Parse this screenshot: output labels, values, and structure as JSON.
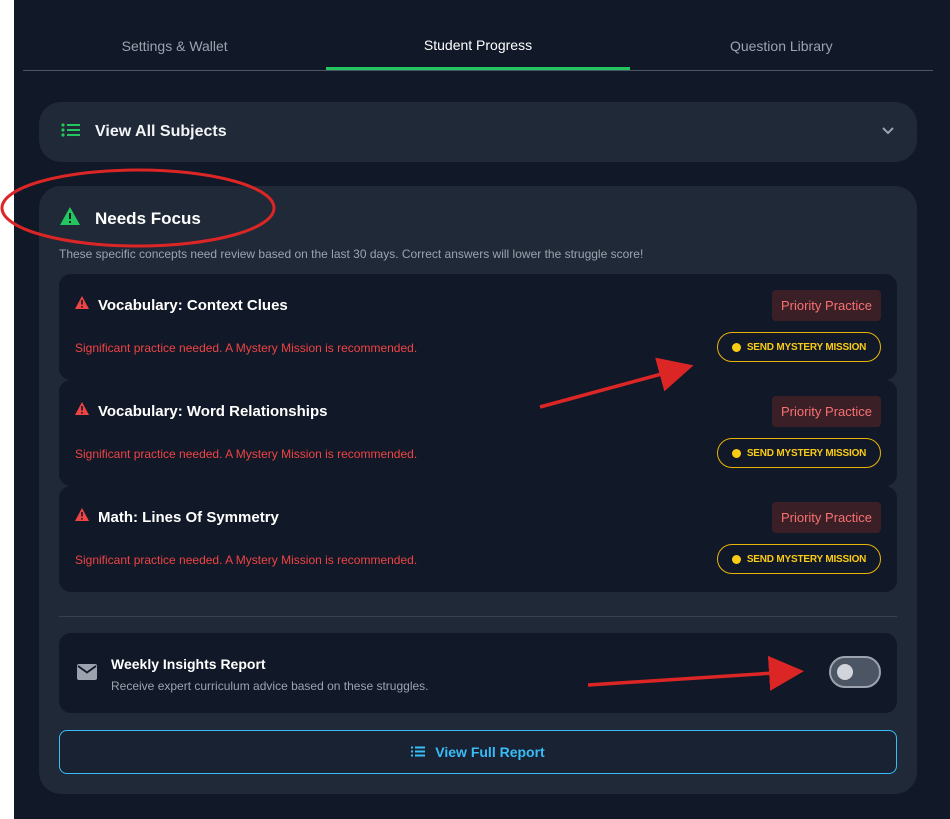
{
  "tabs": [
    {
      "label": "Settings & Wallet",
      "active": false
    },
    {
      "label": "Student Progress",
      "active": true
    },
    {
      "label": "Question Library",
      "active": false
    }
  ],
  "subjects": {
    "title": "View All Subjects",
    "icon": "list-icon",
    "chevron": "chevron-down-icon"
  },
  "focus": {
    "title": "Needs Focus",
    "icon": "warning-icon",
    "description": "These specific concepts need review based on the last 30 days. Correct answers will lower the struggle score!",
    "concepts": [
      {
        "name": "Vocabulary: Context Clues",
        "badge": "Priority Practice",
        "message": "Significant practice needed. A Mystery Mission is recommended.",
        "action": "SEND MYSTERY MISSION"
      },
      {
        "name": "Vocabulary: Word Relationships",
        "badge": "Priority Practice",
        "message": "Significant practice needed. A Mystery Mission is recommended.",
        "action": "SEND MYSTERY MISSION"
      },
      {
        "name": "Math: Lines Of Symmetry",
        "badge": "Priority Practice",
        "message": "Significant practice needed. A Mystery Mission is recommended.",
        "action": "SEND MYSTERY MISSION"
      }
    ]
  },
  "insights": {
    "title": "Weekly Insights Report",
    "subtitle": "Receive expert curriculum advice based on these struggles.",
    "enabled": false,
    "icon": "mail-icon"
  },
  "full_report": {
    "label": "View Full Report",
    "icon": "list-icon"
  },
  "colors": {
    "accent_green": "#22c55e",
    "danger_red": "#ef4444",
    "mission_yellow": "#facc15",
    "link_blue": "#38bdf8",
    "annotation_red": "#dc2626"
  }
}
